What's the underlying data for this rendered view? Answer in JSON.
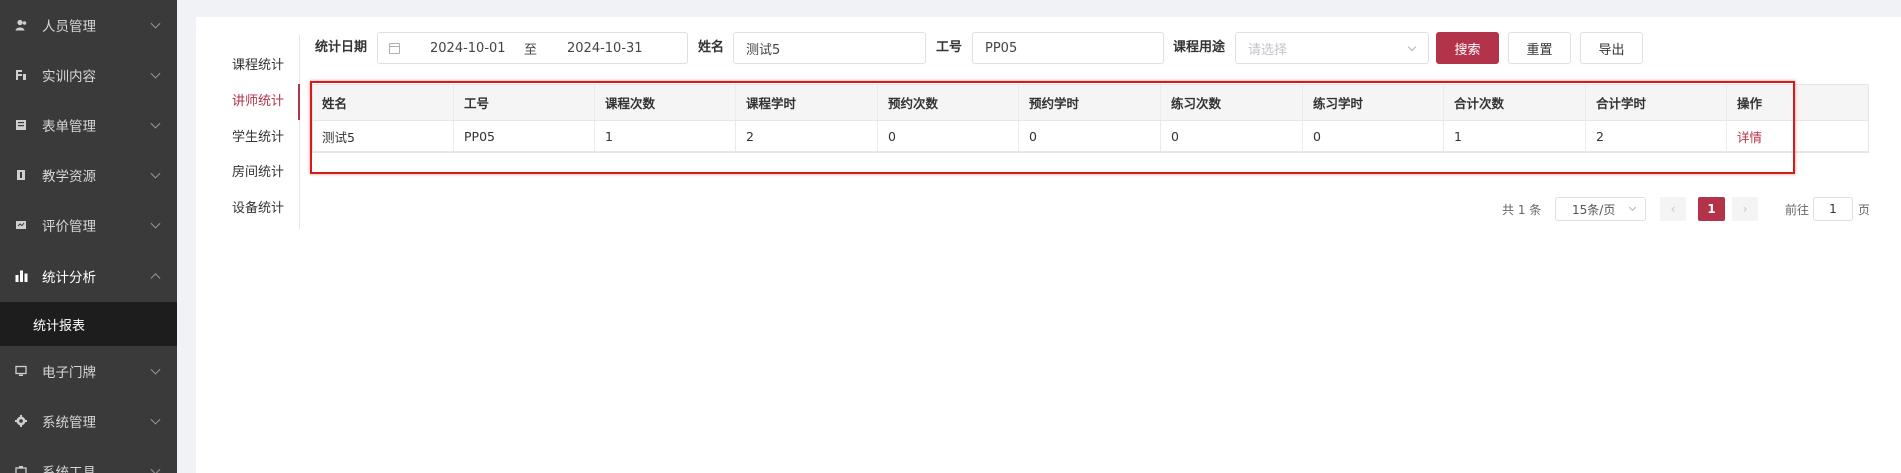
{
  "sidebar": {
    "items": [
      {
        "label": "人员管理",
        "icon": "user-icon"
      },
      {
        "label": "实训内容",
        "icon": "content-icon"
      },
      {
        "label": "表单管理",
        "icon": "form-icon"
      },
      {
        "label": "教学资源",
        "icon": "resource-icon"
      },
      {
        "label": "评价管理",
        "icon": "evaluate-icon"
      },
      {
        "label": "统计分析",
        "icon": "bar-chart-icon"
      },
      {
        "label": "电子门牌",
        "icon": "monitor-icon"
      },
      {
        "label": "系统管理",
        "icon": "gear-icon"
      },
      {
        "label": "系统工具",
        "icon": "tool-icon"
      }
    ],
    "active_sub": "统计报表"
  },
  "subnav": {
    "items": [
      "课程统计",
      "讲师统计",
      "学生统计",
      "房间统计",
      "设备统计"
    ],
    "active": "讲师统计"
  },
  "filters": {
    "date_label": "统计日期",
    "date_start": "2024-10-01",
    "date_sep": "至",
    "date_end": "2024-10-31",
    "name_label": "姓名",
    "name_value": "测试5",
    "job_label": "工号",
    "job_value": "PP05",
    "usage_label": "课程用途",
    "usage_placeholder": "请选择",
    "search_btn": "搜索",
    "reset_btn": "重置",
    "export_btn": "导出"
  },
  "table": {
    "headers": [
      "姓名",
      "工号",
      "课程次数",
      "课程学时",
      "预约次数",
      "预约学时",
      "练习次数",
      "练习学时",
      "合计次数",
      "合计学时",
      "操作"
    ],
    "rows": [
      [
        "测试5",
        "PP05",
        "1",
        "2",
        "0",
        "0",
        "0",
        "0",
        "1",
        "2",
        "详情"
      ]
    ]
  },
  "pagination": {
    "total": "共 1 条",
    "page_size": "15条/页",
    "current": "1",
    "goto_prefix": "前往",
    "goto_value": "1",
    "goto_suffix": "页"
  },
  "colors": {
    "accent": "#b3334a",
    "sidebar_bg": "#3a3a3a",
    "highlight": "#d21b1b"
  }
}
